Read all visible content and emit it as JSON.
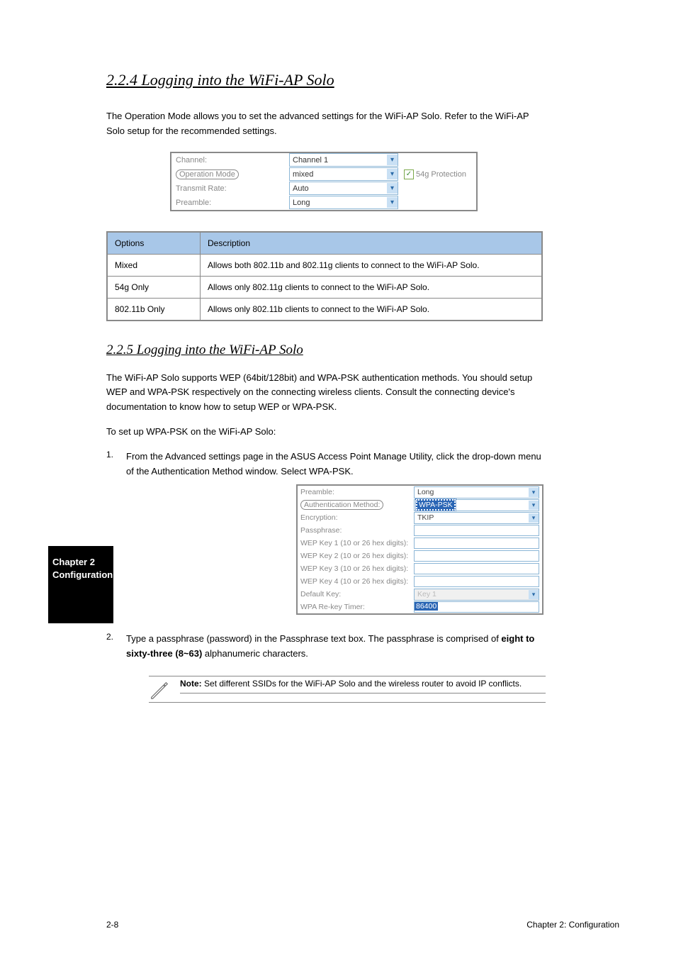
{
  "header_title": "2.2.4 Logging into the WiFi-AP Solo",
  "para1": "The Operation Mode allows you to set the advanced settings for the WiFi-AP Solo. Refer to the WiFi-AP Solo setup for the recommended settings.",
  "shot1": {
    "rows": [
      {
        "label": "Channel:",
        "value": "Channel 1",
        "circled": false,
        "extra": ""
      },
      {
        "label": "Operation Mode",
        "value": "mixed",
        "circled": true,
        "extra": "54g Protection"
      },
      {
        "label": "Transmit Rate:",
        "value": "Auto",
        "circled": false,
        "extra": ""
      },
      {
        "label": "Preamble:",
        "value": "Long",
        "circled": false,
        "extra": ""
      }
    ]
  },
  "table": {
    "h1": "Options",
    "h2": "Description",
    "rows": [
      {
        "c1": "Mixed",
        "c2": "Allows both 802.11b and 802.11g clients to connect to the WiFi-AP Solo."
      },
      {
        "c1": "54g Only",
        "c2": "Allows only 802.11g clients to connect to the WiFi-AP Solo."
      },
      {
        "c1": "802.11b Only",
        "c2": "Allows only 802.11b clients to connect to the WiFi-AP Solo."
      }
    ]
  },
  "subheader": "2.2.5 Logging into the WiFi-AP Solo",
  "para2": "The WiFi-AP Solo supports WEP (64bit/128bit) and WPA-PSK authentication methods. You should setup WEP and WPA-PSK respectively on the connecting wireless clients. Consult the connecting device's documentation to know how to setup WEP or WPA-PSK.",
  "para3": "To set up WPA-PSK on the WiFi-AP Solo:",
  "step1_num": "1.",
  "step1_txt": "From the Advanced settings page in the ASUS Access Point Manage Utility, click the drop-down menu of the Authentication Method window. Select WPA-PSK.",
  "sidebar": "Chapter 2 Configuration",
  "shot2": {
    "rows": [
      {
        "label": "Preamble:",
        "type": "sel",
        "value": "Long",
        "circled": false
      },
      {
        "label": "Authentication Method:",
        "type": "sel",
        "value": "WPA-PSK",
        "circled": true,
        "hl": true
      },
      {
        "label": "Encryption:",
        "type": "sel",
        "value": "TKIP",
        "circled": false
      },
      {
        "label": "Passphrase:",
        "type": "inp",
        "value": ""
      },
      {
        "label": "WEP Key 1 (10 or 26 hex digits):",
        "type": "inp",
        "value": ""
      },
      {
        "label": "WEP Key 2 (10 or 26 hex digits):",
        "type": "inp",
        "value": ""
      },
      {
        "label": "WEP Key 3 (10 or 26 hex digits):",
        "type": "inp",
        "value": ""
      },
      {
        "label": "WEP Key 4 (10 or 26 hex digits):",
        "type": "inp",
        "value": ""
      },
      {
        "label": "Default Key:",
        "type": "sel",
        "value": "Key 1",
        "disabled": true
      },
      {
        "label": "WPA Re-key Timer:",
        "type": "inpv",
        "value": "86400"
      }
    ]
  },
  "step2_num": "2.",
  "step2_txt_a": "Type a passphrase (password) in the Passphrase text box. The passphrase is comprised of ",
  "step2_txt_b": "eight to sixty-three (8~63)",
  "step2_txt_c": " alphanumeric characters.",
  "note_label": "Note:",
  "note_text": "Set different SSIDs for the WiFi-AP Solo and the wireless router to avoid IP conflicts.",
  "footer_left": "2-8",
  "footer_right": "Chapter 2: Configuration"
}
